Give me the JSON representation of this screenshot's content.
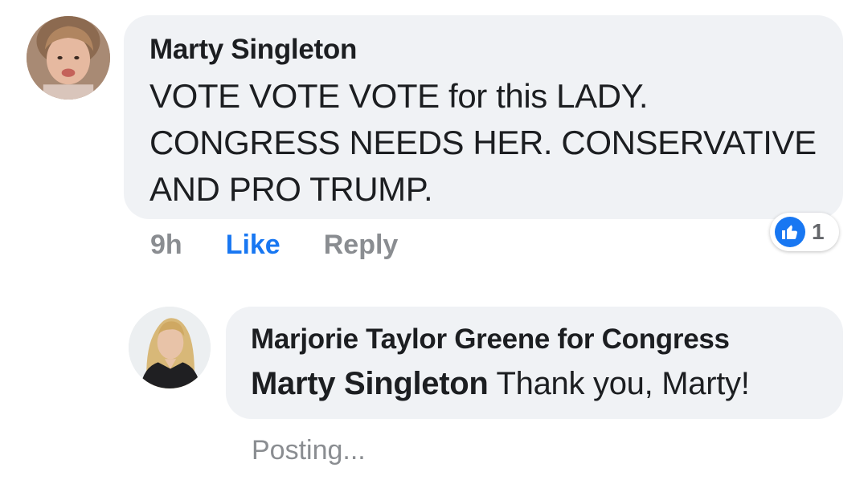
{
  "comment": {
    "author": "Marty Singleton",
    "text": "VOTE VOTE VOTE for this LADY. CONGRESS NEEDS HER. CONSERVATIVE AND PRO TRUMP.",
    "time": "9h",
    "like_label": "Like",
    "reply_label": "Reply",
    "reaction_icon": "thumbs-up-icon",
    "reaction_count": "1",
    "avatar_icon": "child-profile-photo"
  },
  "reply": {
    "author": "Marjorie Taylor Greene for Congress",
    "mention": "Marty Singleton",
    "text": "Thank you, Marty!",
    "status": "Posting...",
    "avatar_icon": "woman-profile-photo"
  },
  "colors": {
    "bubble_bg": "#f0f2f5",
    "like_blue": "#1877f2",
    "meta_gray": "#8a8d91",
    "text": "#1c1e21"
  }
}
